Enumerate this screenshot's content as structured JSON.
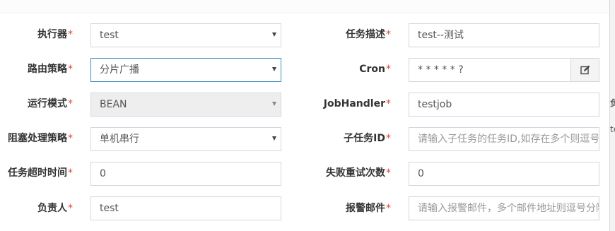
{
  "form": {
    "left": [
      {
        "label": "执行器",
        "required": "*",
        "value": "test",
        "type": "select"
      },
      {
        "label": "路由策略",
        "required": "*",
        "value": "分片广播",
        "type": "select"
      },
      {
        "label": "运行模式",
        "required": "*",
        "value": "BEAN",
        "type": "select"
      },
      {
        "label": "阻塞处理策略",
        "required": "*",
        "value": "单机串行",
        "type": "select"
      },
      {
        "label": "任务超时时间",
        "required": "*",
        "value": "0",
        "type": "input"
      },
      {
        "label": "负责人",
        "required": "*",
        "value": "test",
        "type": "input"
      }
    ],
    "right": [
      {
        "label": "任务描述",
        "required": "*",
        "value": "test--测试",
        "type": "input"
      },
      {
        "label": "Cron",
        "required": "*",
        "value": "* * * * * ?",
        "type": "input"
      },
      {
        "label": "JobHandler",
        "required": "*",
        "value": "testjob",
        "type": "input"
      },
      {
        "label": "子任务ID",
        "required": "*",
        "placeholder": "请输入子任务的任务ID,如存在多个则逗号分隔",
        "type": "input"
      },
      {
        "label": "失败重试次数",
        "required": "*",
        "value": "0",
        "type": "input"
      },
      {
        "label": "报警邮件",
        "required": "*",
        "placeholder": "请输入报警邮件，多个邮件地址则逗号分隔",
        "type": "input"
      }
    ]
  },
  "cron_edit_icon": "edit-icon",
  "edge_fragments": [
    "负",
    "te"
  ],
  "colors": {
    "required": "#dd4b39",
    "focus_border": "#3c8dbc",
    "disabled_bg": "#eeeeee",
    "border": "#d2d6de"
  }
}
